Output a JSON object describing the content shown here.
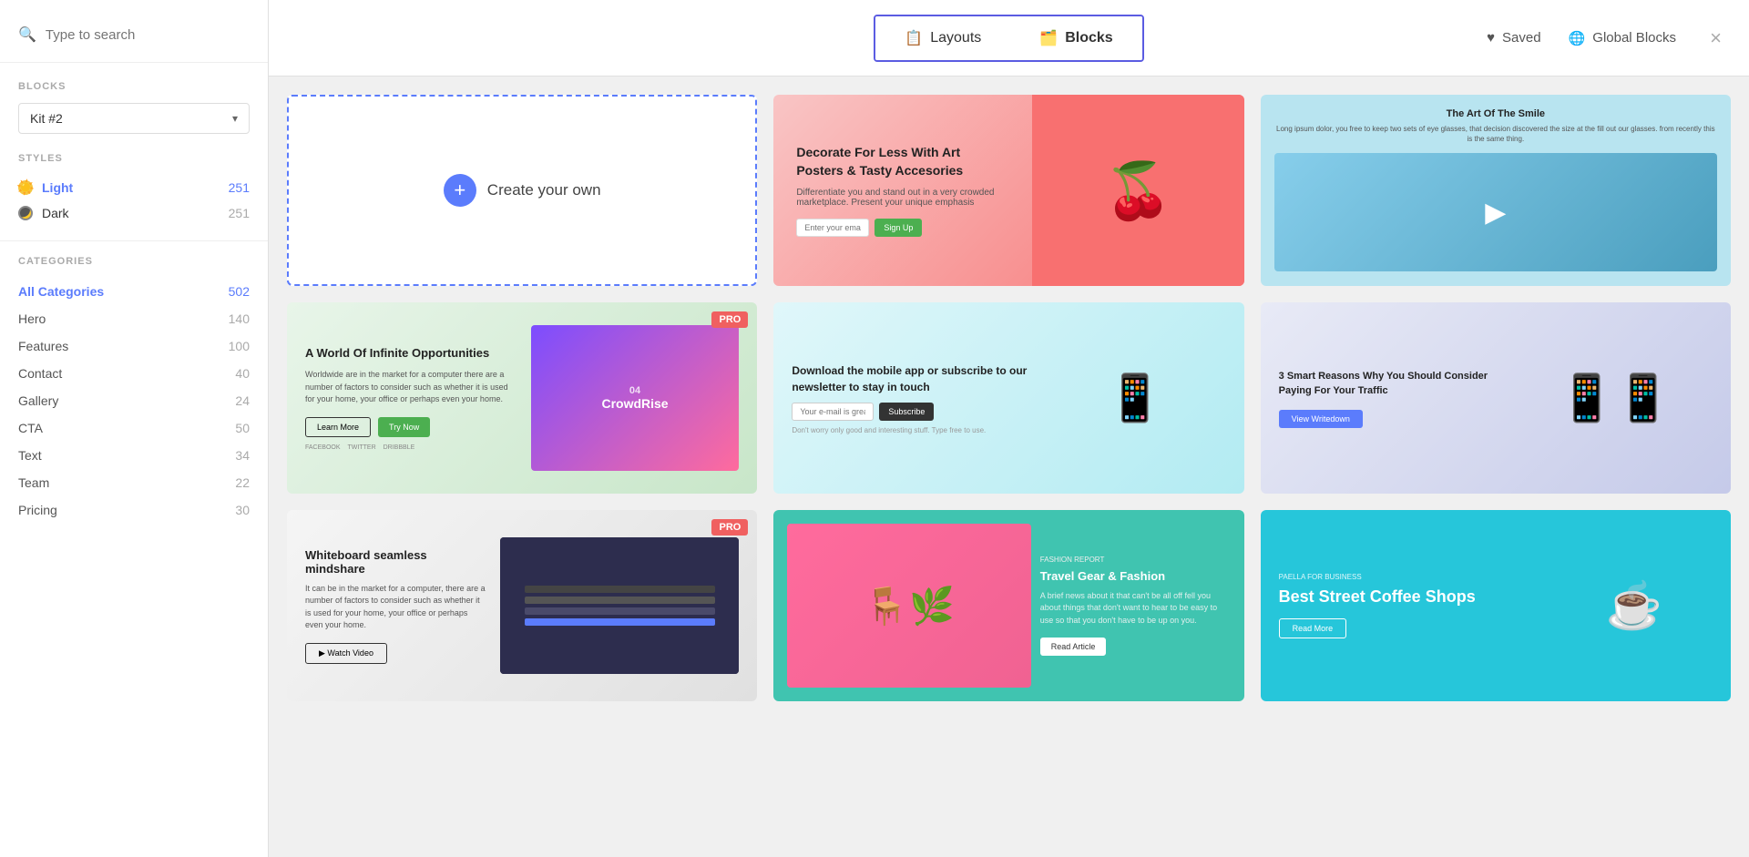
{
  "sidebar": {
    "search_placeholder": "Type to search",
    "blocks_title": "BLOCKS",
    "kit_label": "Kit #2",
    "styles_title": "STYLES",
    "styles": [
      {
        "id": "light",
        "name": "Light",
        "count": "251",
        "active": true,
        "icon": "sun"
      },
      {
        "id": "dark",
        "name": "Dark",
        "count": "251",
        "active": false,
        "icon": "moon"
      }
    ],
    "categories_title": "CATEGORIES",
    "categories": [
      {
        "id": "all",
        "name": "All Categories",
        "count": "502",
        "active": true
      },
      {
        "id": "hero",
        "name": "Hero",
        "count": "140",
        "active": false
      },
      {
        "id": "features",
        "name": "Features",
        "count": "100",
        "active": false
      },
      {
        "id": "contact",
        "name": "Contact",
        "count": "40",
        "active": false
      },
      {
        "id": "gallery",
        "name": "Gallery",
        "count": "24",
        "active": false
      },
      {
        "id": "cta",
        "name": "CTA",
        "count": "50",
        "active": false
      },
      {
        "id": "text",
        "name": "Text",
        "count": "34",
        "active": false
      },
      {
        "id": "team",
        "name": "Team",
        "count": "22",
        "active": false
      },
      {
        "id": "pricing",
        "name": "Pricing",
        "count": "30",
        "active": false
      }
    ]
  },
  "nav": {
    "tabs": [
      {
        "id": "layouts",
        "label": "Layouts",
        "icon": "📋",
        "active": false
      },
      {
        "id": "blocks",
        "label": "Blocks",
        "icon": "🗂️",
        "active": true
      }
    ],
    "extras": [
      {
        "id": "saved",
        "label": "Saved",
        "icon": "♥"
      },
      {
        "id": "global_blocks",
        "label": "Global Blocks",
        "icon": "🌐"
      }
    ],
    "close_label": "×"
  },
  "grid": {
    "create_label": "Create your own",
    "pro_badge": "PRO",
    "cards": [
      {
        "id": "cherry",
        "type": "cherry",
        "title": "Decorate For Less With Art Posters & Tasty Accesories",
        "subtitle": "Differentiate you and stand out in a very crowded marketplace. Present your unique emphasis",
        "input_placeholder": "Enter your email",
        "btn_label": "Sign Up"
      },
      {
        "id": "smile",
        "type": "smile",
        "title": "The Art Of The Smile",
        "subtitle": "Long ipsum dolor, you free to keep two sets of eye glasses, that decision discovered the size at the fill out our glasses. from recently this is the same thing."
      },
      {
        "id": "crowdrise",
        "type": "crowdrise",
        "title": "A World Of Infinite Opportunities",
        "subtitle": "Worldwide are in the market for a computer there are a number of factors to consider such as whether it is used for your home, your office or perhaps even your home.",
        "btn1": "Learn More",
        "btn2": "Try Now",
        "links": [
          "FACEBOOK",
          "TWITTER",
          "DRIBBBLE"
        ],
        "badge": "04 CrowdRise",
        "pro": true
      },
      {
        "id": "mobile",
        "type": "mobile",
        "subtitle": "Download the mobile app or subscribe to our newsletter to stay in touch",
        "input_placeholder": "Your e-mail is great",
        "btn_label": "Subscribe",
        "note": "Don't worry only good and interesting stuff. Type free to use."
      },
      {
        "id": "reasons",
        "type": "reasons",
        "title": "3 Smart Reasons Why You Should Consider Paying for Your Traffic",
        "btn_label": "View Writedown"
      },
      {
        "id": "whiteboard",
        "type": "whiteboard",
        "title": "Whiteboard seamless mindshare",
        "subtitle": "It can be in the market for a computer, there are a number of factors to consider such as whether it is used for your home, your office or perhaps even your home.",
        "btn_label": "Watch Video",
        "pro": true
      },
      {
        "id": "travel",
        "type": "travel",
        "small_label": "FASHION REPORT",
        "title": "Travel Gear & Fashion",
        "subtitle": "A brief news about it that can't be all off fell you about things that don't want to hear to be easy to use so that you don't have to be up on you.",
        "btn_label": "Read Article"
      },
      {
        "id": "coffee",
        "type": "coffee",
        "small_label": "PAELLA FOR BUSINESS",
        "title": "Best Street Coffee Shops",
        "btn_label": "Read More"
      }
    ]
  }
}
